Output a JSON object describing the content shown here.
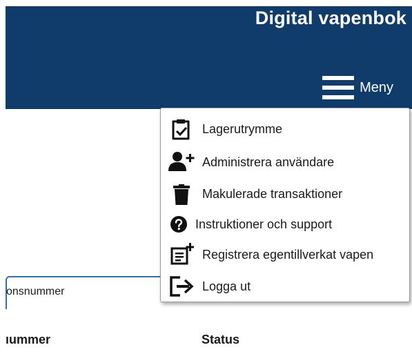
{
  "header": {
    "title": "Digital vapenbok",
    "menu_label": "Meny",
    "menu_icon": "hamburger-icon",
    "background_color": "#0f3c6a"
  },
  "menu": {
    "items": [
      {
        "label": "Lagerutrymme",
        "icon": "clipboard-check-icon"
      },
      {
        "label": "Administrera användare",
        "icon": "user-add-icon"
      },
      {
        "label": "Makulerade transaktioner",
        "icon": "trash-icon"
      },
      {
        "label": "Instruktioner och support",
        "icon": "question-circle-icon"
      },
      {
        "label": "Registrera egentillverkat vapen",
        "icon": "document-add-icon"
      },
      {
        "label": "Logga ut",
        "icon": "logout-icon"
      }
    ]
  },
  "background": {
    "field_label": "onsnummer",
    "column_left": "ıummer",
    "column_status": "Status",
    "accent_color": "#2f6fb5"
  }
}
